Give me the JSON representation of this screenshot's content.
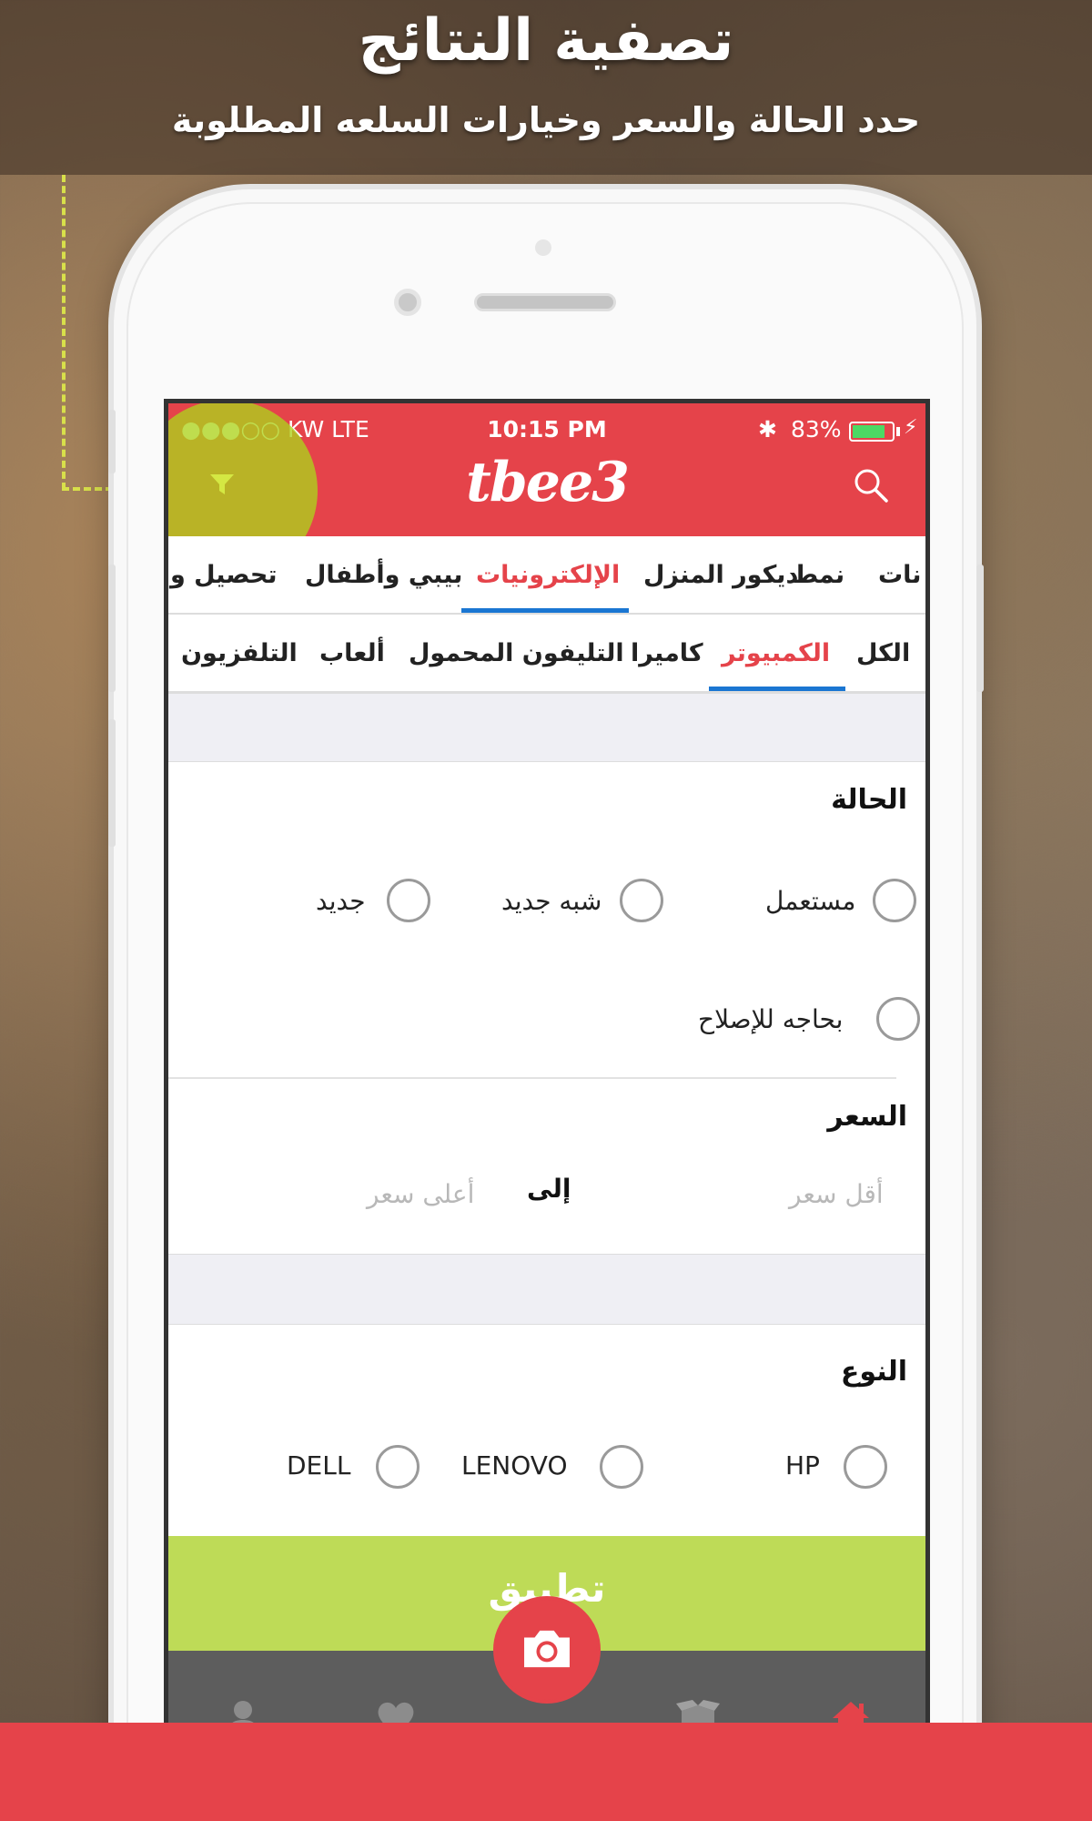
{
  "promo": {
    "headline": "تصفية النتائج",
    "subline": "حدد الحالة والسعر وخيارات السلعه المطلوبة"
  },
  "status_bar": {
    "signal": "●●●○○ KW   LTE",
    "time": "10:15 PM",
    "bluetooth": "✱",
    "battery": "83%",
    "battery_level": 0.83
  },
  "app": {
    "logo": "tbee3",
    "brand_color": "#e5434a",
    "accent_color": "#bedb57",
    "left_icon": "filter-icon",
    "right_icon": "search-icon"
  },
  "category_tabs": [
    {
      "label": "نات",
      "active": false
    },
    {
      "label": "نمط",
      "active": false
    },
    {
      "label": "ديكور المنزل",
      "active": false
    },
    {
      "label": "الإلكترونيات",
      "active": true
    },
    {
      "label": "بيبي وأطفال",
      "active": false
    },
    {
      "label": "تحصيل و",
      "active": false
    }
  ],
  "subcategory_tabs": [
    {
      "label": "الكل",
      "active": false
    },
    {
      "label": "الكمبيوتر",
      "active": true
    },
    {
      "label": "كاميرا",
      "active": false
    },
    {
      "label": "التليفون المحمول",
      "active": false
    },
    {
      "label": "ألعاب",
      "active": false
    },
    {
      "label": "التلفزيون",
      "active": false
    }
  ],
  "condition": {
    "title": "الحالة",
    "options": [
      "مستعمل",
      "شبه جديد",
      "جديد",
      "بحاجه للإصلاح"
    ]
  },
  "price": {
    "title": "السعر",
    "min_placeholder": "أقل سعر",
    "to_label": "إلى",
    "max_placeholder": "أعلى سعر"
  },
  "type": {
    "title": "النوع",
    "options": [
      "HP",
      "LENOVO",
      "DELL"
    ]
  },
  "apply_button": "تطبيق",
  "tab_bar": [
    "home-icon",
    "box-icon",
    "camera-icon",
    "heart-icon",
    "user-icon"
  ]
}
